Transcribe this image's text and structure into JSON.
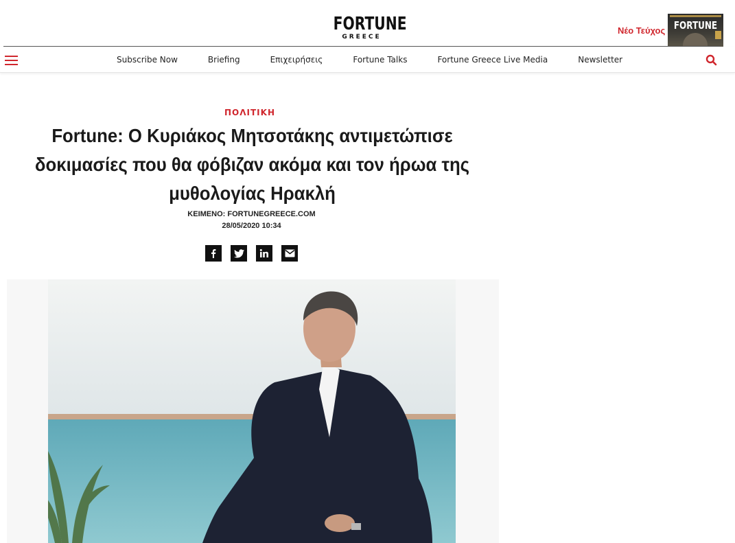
{
  "header": {
    "logo_main": "FORTUNE",
    "logo_sub": "GREECE",
    "new_issue_label": "Νέο Τεύχος",
    "cover_title": "FORTUNE"
  },
  "nav": {
    "items": [
      {
        "label": "Subscribe Now"
      },
      {
        "label": "Briefing"
      },
      {
        "label": "Επιχειρήσεις"
      },
      {
        "label": "Fortune Talks"
      },
      {
        "label": "Fortune Greece Live Media"
      },
      {
        "label": "Newsletter"
      }
    ],
    "icons": {
      "menu": "hamburger-menu-icon",
      "search": "search-icon"
    }
  },
  "article": {
    "category": "ΠΟΛΙΤΙΚΗ",
    "headline_lines": [
      "Fortune: Ο Κυριάκος Μητσοτάκης αντιμετώπισε",
      "δοκιμασίες που θα φόβιζαν ακόμα και τον ήρωα της",
      "μυθολογίας Ηρακλή"
    ],
    "author": "ΚΕΙΜΕΝΟ: FORTUNEGREECE.COM",
    "date": "28/05/2020 10:34",
    "share_icons": [
      "facebook-icon",
      "twitter-icon",
      "linkedin-icon",
      "email-icon"
    ]
  },
  "colors": {
    "accent": "#d0262d",
    "text": "#111111",
    "share_bg": "#111111"
  }
}
